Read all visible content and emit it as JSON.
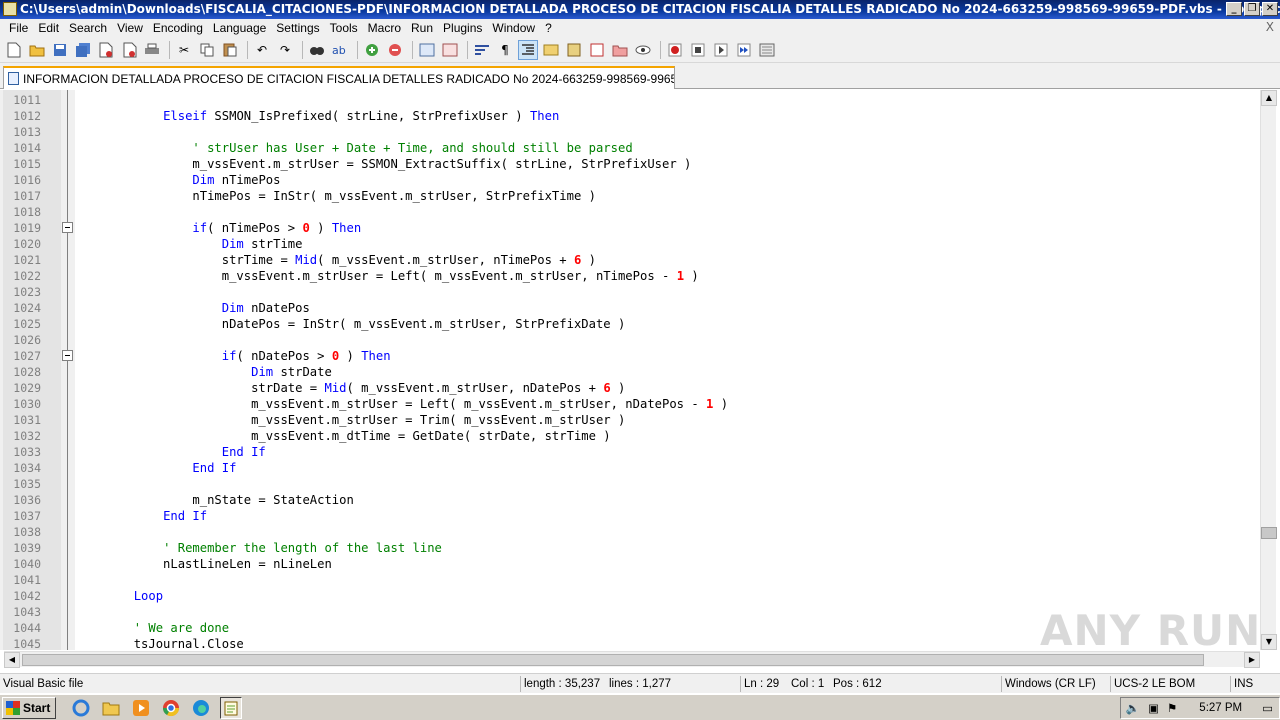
{
  "window": {
    "title": "C:\\Users\\admin\\Downloads\\FISCALIA_CITACIONES-PDF\\INFORMACION DETALLADA PROCESO DE CITACION FISCALIA DETALLES RADICADO No 2024-663259-998569-99659-PDF.vbs - Notepad++",
    "buttons": [
      "_",
      "❐",
      "✕"
    ]
  },
  "menu": {
    "items": [
      "File",
      "Edit",
      "Search",
      "View",
      "Encoding",
      "Language",
      "Settings",
      "Tools",
      "Macro",
      "Run",
      "Plugins",
      "Window",
      "?"
    ],
    "close": "X"
  },
  "toolbar": {
    "icons": [
      "new-file",
      "open-file",
      "save",
      "save-all",
      "close",
      "close-all",
      "print",
      "cut",
      "copy",
      "paste",
      "undo",
      "redo",
      "find",
      "replace",
      "zoom-in",
      "zoom-out",
      "sync-vertical",
      "sync-horizontal",
      "word-wrap",
      "show-all-chars",
      "indent-guide",
      "udl",
      "doc-map",
      "function-list",
      "folder-workspace",
      "monitoring",
      "record-macro",
      "stop-macro",
      "play-macro",
      "run-macro-multiple",
      "save-macro"
    ]
  },
  "tab": {
    "label": "INFORMACION DETALLADA PROCESO DE CITACION FISCALIA DETALLES RADICADO No 2024-663259-998569-99659-PDF.vbs"
  },
  "editor": {
    "lines": [
      {
        "n": "1011",
        "segs": []
      },
      {
        "n": "1012",
        "segs": [
          [
            "tx",
            "            "
          ],
          [
            "kw",
            "Elseif"
          ],
          [
            "tx",
            " SSMON_IsPrefixed( strLine, StrPrefixUser ) "
          ],
          [
            "kw",
            "Then"
          ]
        ]
      },
      {
        "n": "1013",
        "segs": []
      },
      {
        "n": "1014",
        "segs": [
          [
            "tx",
            "                "
          ],
          [
            "cm",
            "' strUser has User + Date + Time, and should still be parsed"
          ]
        ]
      },
      {
        "n": "1015",
        "segs": [
          [
            "tx",
            "                m_vssEvent.m_strUser = SSMON_ExtractSuffix( strLine, StrPrefixUser )"
          ]
        ]
      },
      {
        "n": "1016",
        "segs": [
          [
            "tx",
            "                "
          ],
          [
            "kw",
            "Dim"
          ],
          [
            "tx",
            " nTimePos"
          ]
        ]
      },
      {
        "n": "1017",
        "segs": [
          [
            "tx",
            "                nTimePos = InStr( m_vssEvent.m_strUser, StrPrefixTime )"
          ]
        ]
      },
      {
        "n": "1018",
        "segs": []
      },
      {
        "n": "1019",
        "segs": [
          [
            "tx",
            "                "
          ],
          [
            "kw",
            "if"
          ],
          [
            "tx",
            "( nTimePos > "
          ],
          [
            "nm",
            "0"
          ],
          [
            "tx",
            " ) "
          ],
          [
            "kw",
            "Then"
          ]
        ],
        "fold": true
      },
      {
        "n": "1020",
        "segs": [
          [
            "tx",
            "                    "
          ],
          [
            "kw",
            "Dim"
          ],
          [
            "tx",
            " strTime"
          ]
        ]
      },
      {
        "n": "1021",
        "segs": [
          [
            "tx",
            "                    strTime = "
          ],
          [
            "kw",
            "Mid"
          ],
          [
            "tx",
            "( m_vssEvent.m_strUser, nTimePos + "
          ],
          [
            "nm",
            "6"
          ],
          [
            "tx",
            " )"
          ]
        ]
      },
      {
        "n": "1022",
        "segs": [
          [
            "tx",
            "                    m_vssEvent.m_strUser = Left( m_vssEvent.m_strUser, nTimePos - "
          ],
          [
            "nm",
            "1"
          ],
          [
            "tx",
            " )"
          ]
        ]
      },
      {
        "n": "1023",
        "segs": []
      },
      {
        "n": "1024",
        "segs": [
          [
            "tx",
            "                    "
          ],
          [
            "kw",
            "Dim"
          ],
          [
            "tx",
            " nDatePos"
          ]
        ]
      },
      {
        "n": "1025",
        "segs": [
          [
            "tx",
            "                    nDatePos = InStr( m_vssEvent.m_strUser, StrPrefixDate )"
          ]
        ]
      },
      {
        "n": "1026",
        "segs": []
      },
      {
        "n": "1027",
        "segs": [
          [
            "tx",
            "                    "
          ],
          [
            "kw",
            "if"
          ],
          [
            "tx",
            "( nDatePos > "
          ],
          [
            "nm",
            "0"
          ],
          [
            "tx",
            " ) "
          ],
          [
            "kw",
            "Then"
          ]
        ],
        "fold": true
      },
      {
        "n": "1028",
        "segs": [
          [
            "tx",
            "                        "
          ],
          [
            "kw",
            "Dim"
          ],
          [
            "tx",
            " strDate"
          ]
        ]
      },
      {
        "n": "1029",
        "segs": [
          [
            "tx",
            "                        strDate = "
          ],
          [
            "kw",
            "Mid"
          ],
          [
            "tx",
            "( m_vssEvent.m_strUser, nDatePos + "
          ],
          [
            "nm",
            "6"
          ],
          [
            "tx",
            " )"
          ]
        ]
      },
      {
        "n": "1030",
        "segs": [
          [
            "tx",
            "                        m_vssEvent.m_strUser = Left( m_vssEvent.m_strUser, nDatePos - "
          ],
          [
            "nm",
            "1"
          ],
          [
            "tx",
            " )"
          ]
        ]
      },
      {
        "n": "1031",
        "segs": [
          [
            "tx",
            "                        m_vssEvent.m_strUser = Trim( m_vssEvent.m_strUser )"
          ]
        ]
      },
      {
        "n": "1032",
        "segs": [
          [
            "tx",
            "                        m_vssEvent.m_dtTime = GetDate( strDate, strTime )"
          ]
        ]
      },
      {
        "n": "1033",
        "segs": [
          [
            "tx",
            "                    "
          ],
          [
            "kw",
            "End If"
          ]
        ]
      },
      {
        "n": "1034",
        "segs": [
          [
            "tx",
            "                "
          ],
          [
            "kw",
            "End If"
          ]
        ]
      },
      {
        "n": "1035",
        "segs": []
      },
      {
        "n": "1036",
        "segs": [
          [
            "tx",
            "                m_nState = StateAction"
          ]
        ]
      },
      {
        "n": "1037",
        "segs": [
          [
            "tx",
            "            "
          ],
          [
            "kw",
            "End If"
          ]
        ]
      },
      {
        "n": "1038",
        "segs": []
      },
      {
        "n": "1039",
        "segs": [
          [
            "tx",
            "            "
          ],
          [
            "cm",
            "' Remember the length of the last line"
          ]
        ]
      },
      {
        "n": "1040",
        "segs": [
          [
            "tx",
            "            nLastLineLen = nLineLen"
          ]
        ]
      },
      {
        "n": "1041",
        "segs": []
      },
      {
        "n": "1042",
        "segs": [
          [
            "tx",
            "        "
          ],
          [
            "kw",
            "Loop"
          ]
        ]
      },
      {
        "n": "1043",
        "segs": []
      },
      {
        "n": "1044",
        "segs": [
          [
            "tx",
            "        "
          ],
          [
            "cm",
            "' We are done"
          ]
        ]
      },
      {
        "n": "1045",
        "segs": [
          [
            "tx",
            "        tsJournal.Close"
          ]
        ]
      }
    ]
  },
  "watermark": "ANY RUN",
  "status": {
    "language": "Visual Basic file",
    "length": "length : 35,237",
    "lines": "lines : 1,277",
    "ln": "Ln : 29",
    "col": "Col : 1",
    "pos": "Pos : 612",
    "eol": "Windows (CR LF)",
    "encoding": "UCS-2 LE BOM",
    "mode": "INS"
  },
  "taskbar": {
    "start": "Start",
    "apps": [
      "ie-icon",
      "explorer-icon",
      "media-player-icon",
      "chrome-icon",
      "edge-icon",
      "notepad-plus-plus-icon"
    ],
    "clock": "5:27 PM"
  }
}
